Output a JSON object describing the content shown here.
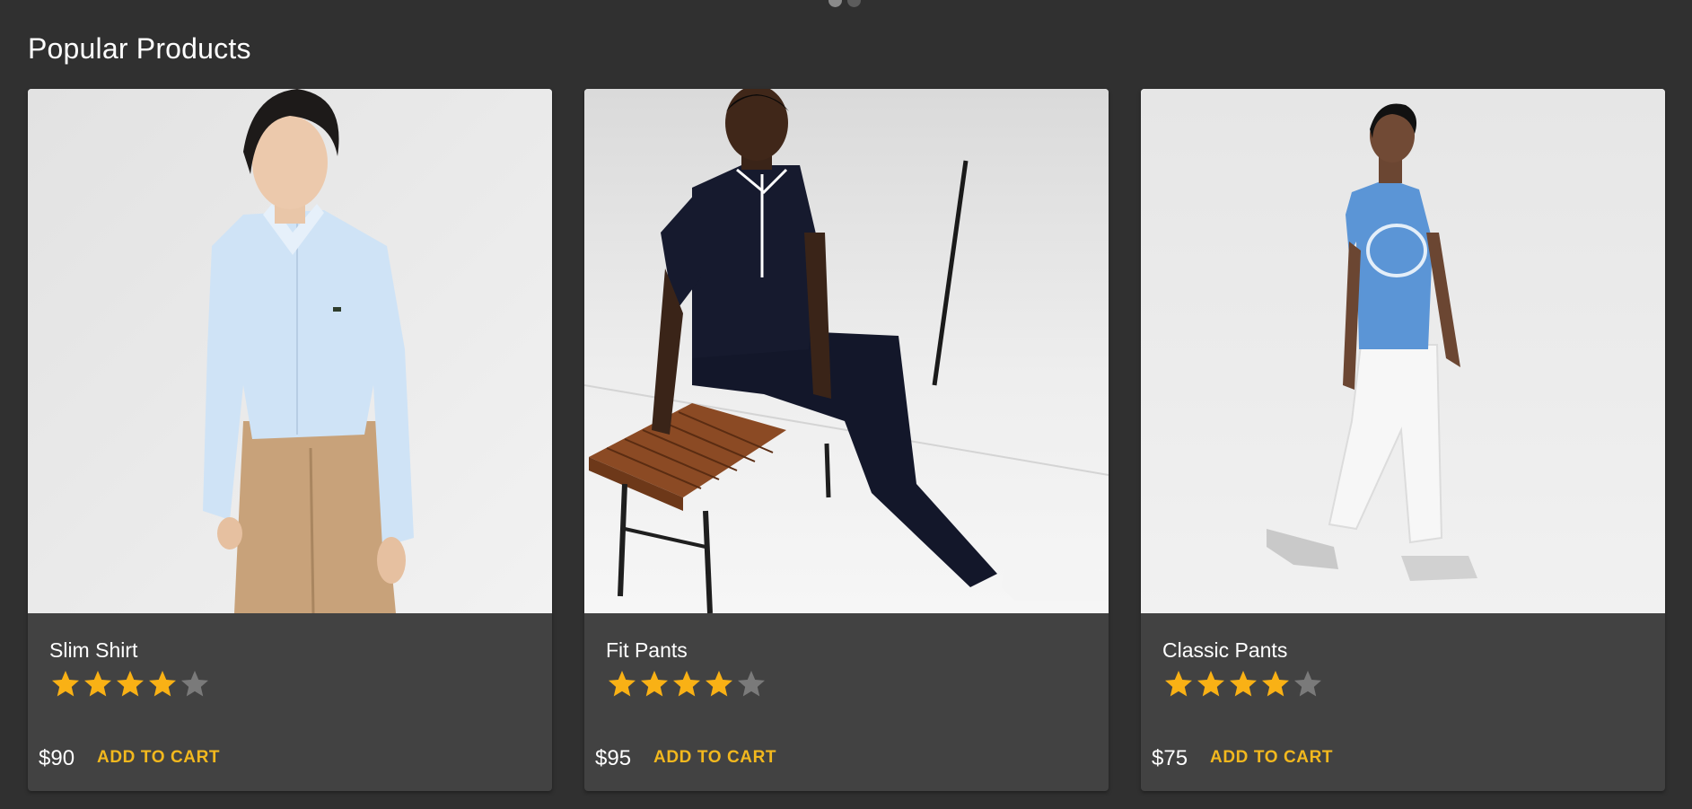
{
  "carousel": {
    "dots": [
      {
        "active": true
      },
      {
        "active": false
      }
    ]
  },
  "section": {
    "title": "Popular Products"
  },
  "colors": {
    "star_filled": "#f9b115",
    "star_empty": "#7a7a7a",
    "accent": "#f2b81e",
    "card_bg": "#424242",
    "page_bg": "#303030"
  },
  "products": [
    {
      "name": "Slim Shirt",
      "price": "$90",
      "rating": 4,
      "max_rating": 5,
      "action": "ADD TO CART",
      "image": "model-light-blue-shirt-khaki-pants"
    },
    {
      "name": "Fit Pants",
      "price": "$95",
      "rating": 4,
      "max_rating": 5,
      "action": "ADD TO CART",
      "image": "model-navy-polo-seated-bench"
    },
    {
      "name": "Classic Pants",
      "price": "$75",
      "rating": 4,
      "max_rating": 5,
      "action": "ADD TO CART",
      "image": "model-blue-tee-white-pants-walking"
    }
  ]
}
